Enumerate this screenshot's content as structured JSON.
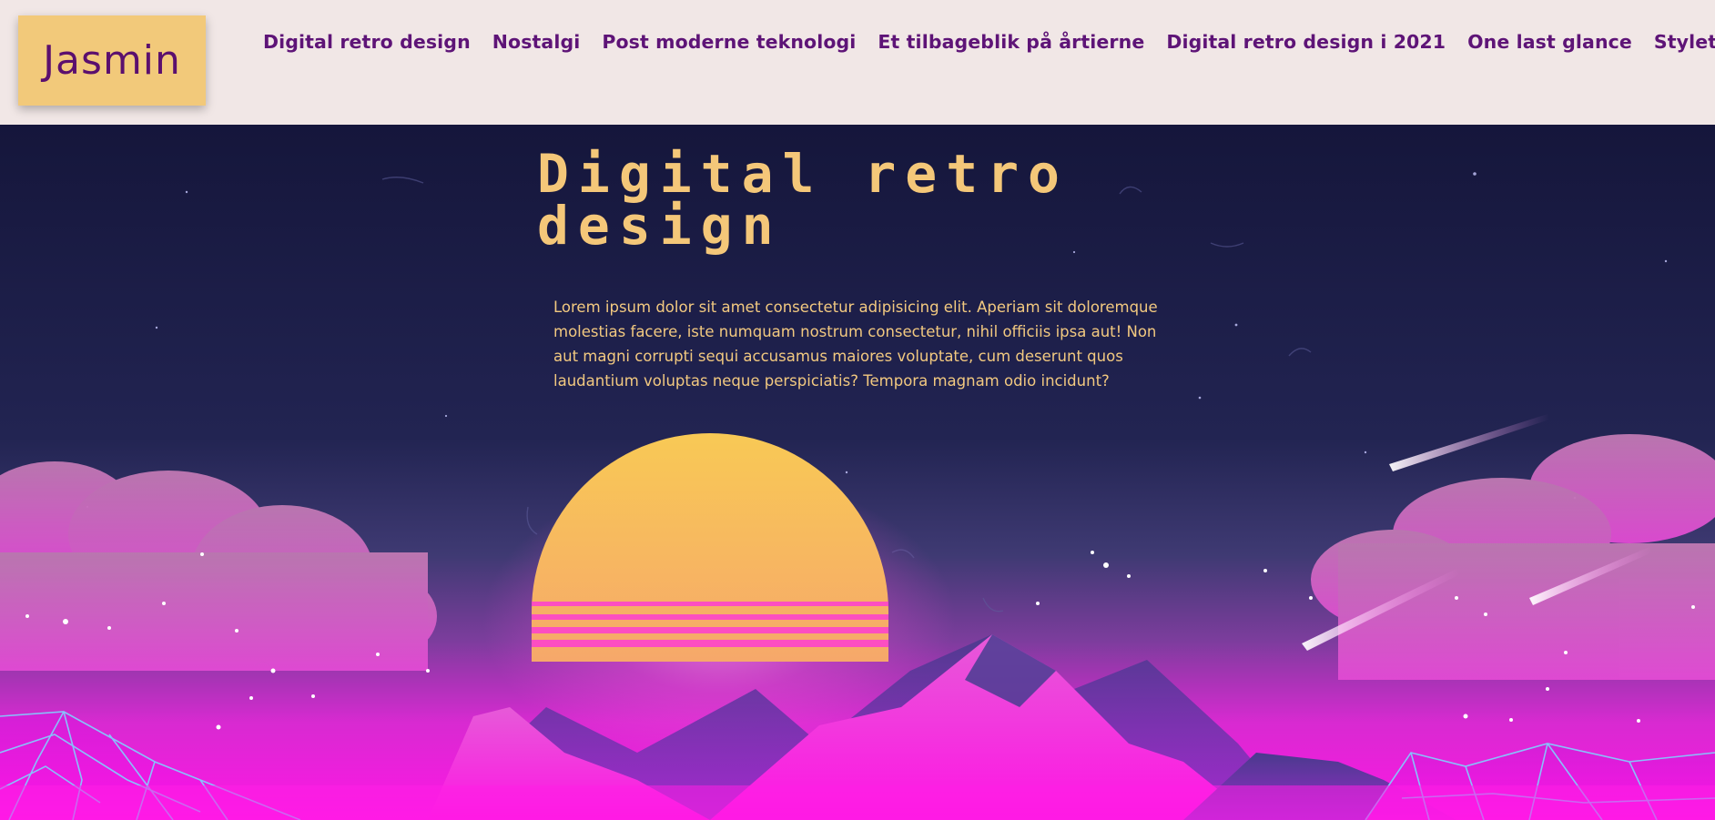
{
  "logo": {
    "text": "Jasmin"
  },
  "nav": {
    "items": [
      "Digital retro design",
      "Nostalgi",
      "Post moderne teknologi",
      "Et tilbageblik på årtierne",
      "Digital retro design i 2021",
      "One last glance",
      "Styletile"
    ]
  },
  "hero": {
    "title": "Digital retro design",
    "description": "Lorem ipsum dolor sit amet consectetur adipisicing elit. Aperiam sit doloremque molestias facere, iste numquam nostrum consectetur, nihil officiis ipsa aut! Non aut magni corrupti sequi accusamus maiores voluptate, cum deserunt quos laudantium voluptas neque perspiciatis? Tempora magnam odio incidunt?"
  },
  "colors": {
    "header_bg": "#f1e7e6",
    "logo_bg": "#f2c97a",
    "nav_text": "#5e1477",
    "title_text": "#f4c779",
    "sky_top": "#14163a",
    "magenta": "#ff1fe0",
    "sun": "#f7c85a"
  },
  "icons": {
    "hero_image": "retro-synthwave-landscape"
  }
}
